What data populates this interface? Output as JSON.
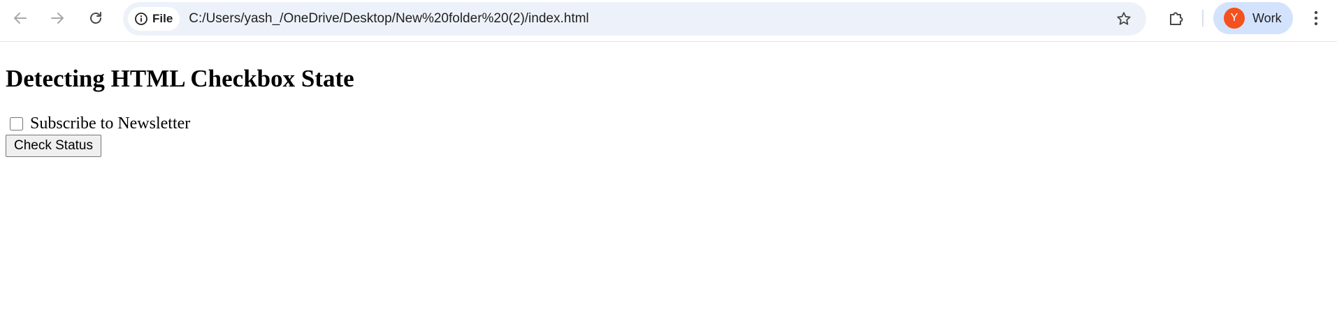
{
  "browser": {
    "site_chip_label": "File",
    "url": "C:/Users/yash_/OneDrive/Desktop/New%20folder%20(2)/index.html",
    "profile": {
      "initial": "Y",
      "label": "Work",
      "avatar_color": "#f4511e"
    },
    "icons": {
      "back": "arrow-left-icon",
      "forward": "arrow-right-icon",
      "reload": "reload-icon",
      "info": "info-icon",
      "bookmark": "star-icon",
      "extensions": "puzzle-icon",
      "menu": "kebab-menu-icon"
    }
  },
  "page": {
    "heading": "Detecting HTML Checkbox State",
    "checkbox": {
      "label": "Subscribe to Newsletter",
      "checked": false
    },
    "button_label": "Check Status"
  }
}
